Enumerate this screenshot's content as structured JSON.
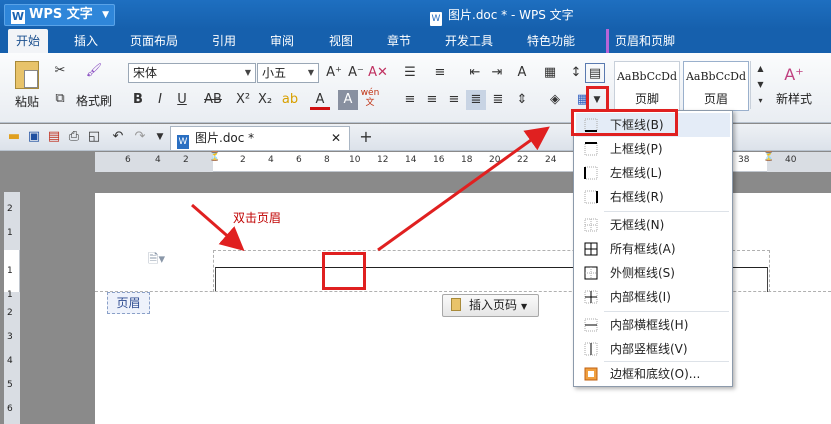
{
  "app": {
    "name": "WPS 文字",
    "title": "图片.doc * - WPS 文字"
  },
  "tabs": [
    {
      "label": "开始",
      "active": true
    },
    {
      "label": "插入"
    },
    {
      "label": "页面布局"
    },
    {
      "label": "引用"
    },
    {
      "label": "审阅"
    },
    {
      "label": "视图"
    },
    {
      "label": "章节"
    },
    {
      "label": "开发工具"
    },
    {
      "label": "特色功能"
    },
    {
      "label": "页眉和页脚"
    }
  ],
  "ribbon": {
    "paste": "粘贴",
    "format_painter": "格式刷",
    "font_name": "宋体",
    "font_size": "小五",
    "styles": [
      {
        "sample": "AaBbCcDd",
        "name": "页脚"
      },
      {
        "sample": "AaBbCcDd",
        "name": "页眉"
      }
    ],
    "new_style": "新样式"
  },
  "document_tab": "图片.doc *",
  "ruler_numbers": [
    "6",
    "4",
    "2",
    "2",
    "4",
    "6",
    "8",
    "10",
    "12",
    "14",
    "16",
    "18",
    "20",
    "22",
    "24",
    "38",
    "40"
  ],
  "vruler_numbers": [
    "2",
    "1",
    "1",
    "1",
    "2",
    "3",
    "4",
    "5",
    "6",
    "7",
    "8"
  ],
  "header_label": "页眉",
  "insert_page_number": "插入页码",
  "annotation": "双击页眉",
  "border_menu": [
    {
      "label": "下框线(B)",
      "icon": "bottom-border-icon"
    },
    {
      "label": "上框线(P)",
      "icon": "top-border-icon"
    },
    {
      "label": "左框线(L)",
      "icon": "left-border-icon"
    },
    {
      "label": "右框线(R)",
      "icon": "right-border-icon"
    },
    {
      "label": "无框线(N)",
      "icon": "no-border-icon"
    },
    {
      "label": "所有框线(A)",
      "icon": "all-borders-icon"
    },
    {
      "label": "外侧框线(S)",
      "icon": "outside-borders-icon"
    },
    {
      "label": "内部框线(I)",
      "icon": "inside-borders-icon"
    },
    {
      "label": "内部横框线(H)",
      "icon": "inside-horizontal-border-icon"
    },
    {
      "label": "内部竖框线(V)",
      "icon": "inside-vertical-border-icon"
    },
    {
      "label": "边框和底纹(O)...",
      "icon": "borders-shading-icon"
    }
  ],
  "colors": {
    "title_blue": "#1660ad",
    "highlight_red": "#e02020",
    "annotation_red": "#c00000"
  }
}
